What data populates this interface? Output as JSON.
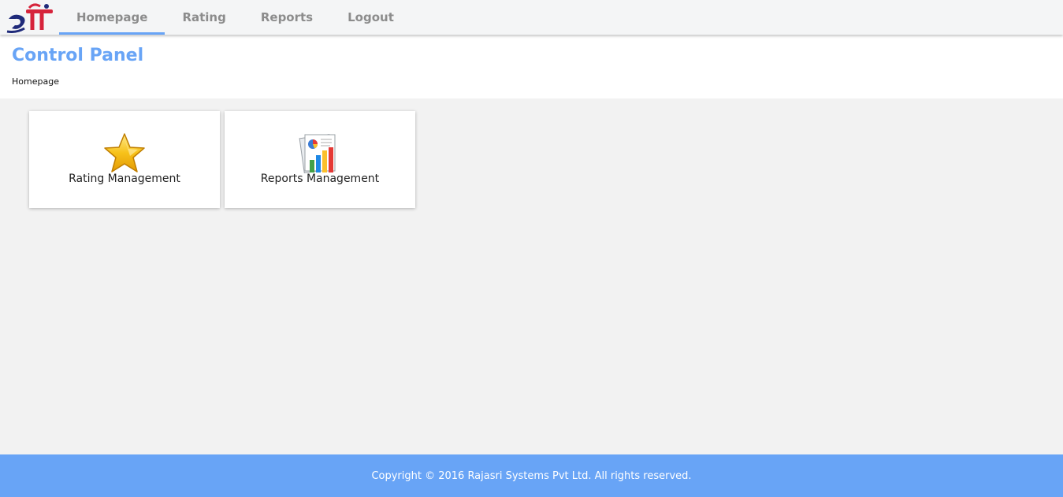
{
  "nav": {
    "logo_icon": "rajasri-logo",
    "items": [
      {
        "label": "Homepage",
        "active": true
      },
      {
        "label": "Rating",
        "active": false
      },
      {
        "label": "Reports",
        "active": false
      },
      {
        "label": "Logout",
        "active": false
      }
    ]
  },
  "header": {
    "title": "Control Panel",
    "breadcrumb": "Homepage"
  },
  "tiles": [
    {
      "label": "Rating Management",
      "icon": "star-icon"
    },
    {
      "label": "Reports Management",
      "icon": "bar-chart-report-icon"
    }
  ],
  "footer": {
    "copyright": "Copyright © 2016 Rajasri Systems Pvt Ltd. All rights reserved."
  },
  "colors": {
    "accent": "#68a4f6",
    "nav_text": "#8c8c8c",
    "background": "#f2f2f2"
  }
}
